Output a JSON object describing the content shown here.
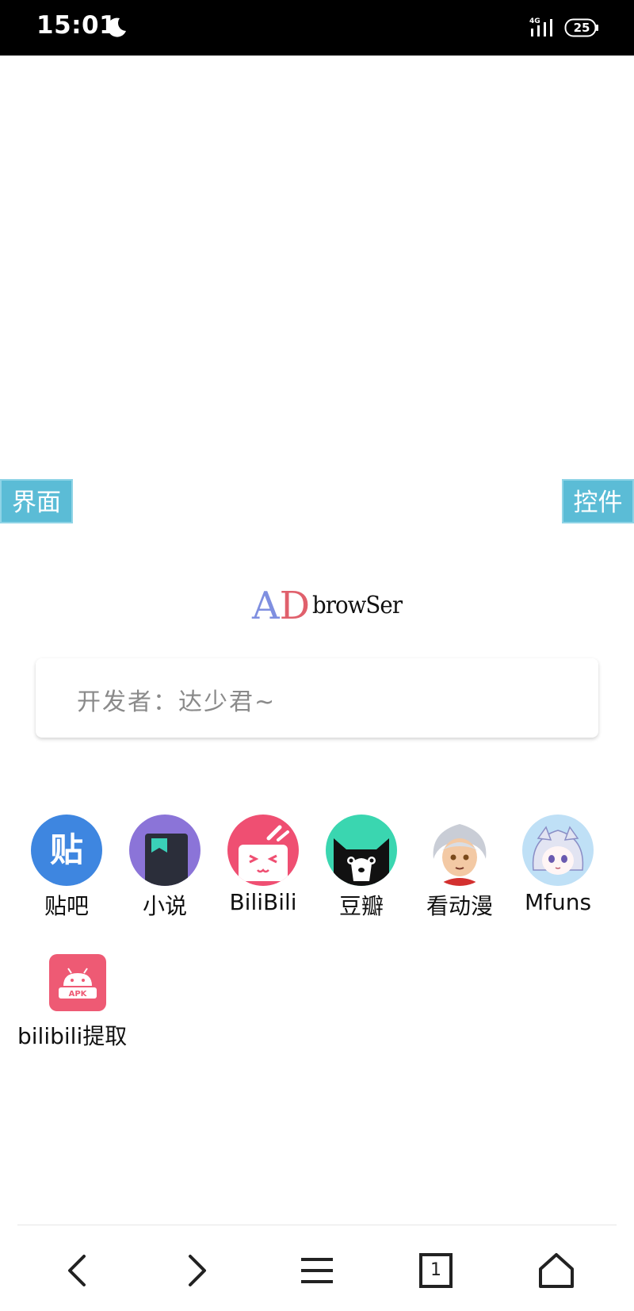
{
  "status_bar": {
    "time": "15:01",
    "network": "4G",
    "battery": "25",
    "icons": [
      "moon-icon",
      "signal-icon",
      "battery-icon"
    ]
  },
  "side_tabs": {
    "left": "界面",
    "right": "控件"
  },
  "logo": {
    "a": "A",
    "d": "D",
    "browser": "browSer"
  },
  "search": {
    "placeholder": "开发者：达少君~"
  },
  "shortcuts": [
    {
      "label": "贴吧",
      "icon": "tieba-icon",
      "glyph": "贴",
      "color": "#3e86e0"
    },
    {
      "label": "小说",
      "icon": "novel-icon",
      "color": "#8b74d8"
    },
    {
      "label": "BiliBili",
      "icon": "bilibili-icon",
      "color": "#ef4f72"
    },
    {
      "label": "豆瓣",
      "icon": "douban-cat-icon",
      "color": "#3ad6b0"
    },
    {
      "label": "看动漫",
      "icon": "anime-character-icon"
    },
    {
      "label": "Mfuns",
      "icon": "mfuns-character-icon",
      "color": "#bfe0f6"
    },
    {
      "label": "bilibili提取",
      "icon": "apk-android-icon",
      "badge": "APK",
      "color": "#ee5a74"
    }
  ],
  "bottom_nav": {
    "tab_count": "1",
    "icons": [
      "back-icon",
      "forward-icon",
      "menu-icon",
      "tabs-icon",
      "home-icon"
    ]
  }
}
